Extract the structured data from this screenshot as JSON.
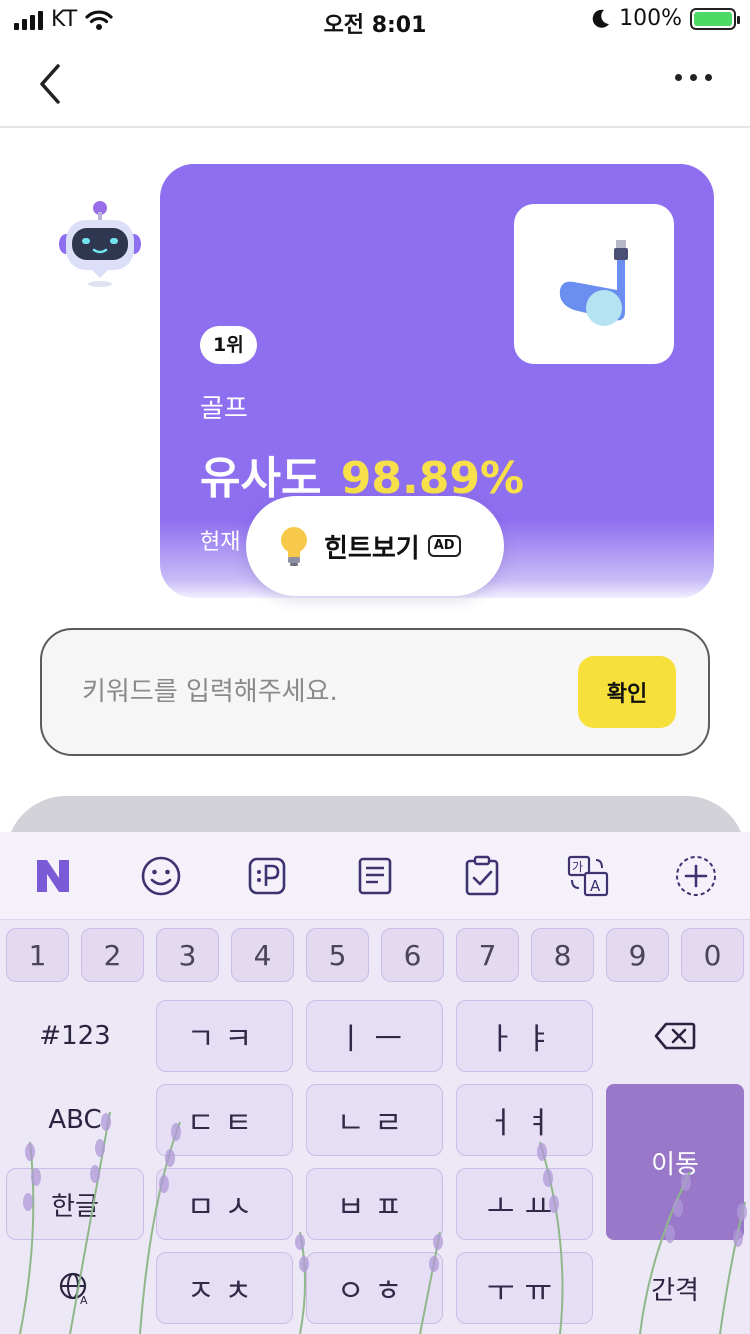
{
  "status_bar": {
    "carrier": "KT",
    "time": "오전 8:01",
    "battery": "100%"
  },
  "card": {
    "rank": "1위",
    "category": "골프",
    "similarity_label": "유사도",
    "similarity_value": "98.89%",
    "current_label": "현재"
  },
  "hint": {
    "label": "힌트보기",
    "ad": "AD"
  },
  "input": {
    "placeholder": "키워드를 입력해주세요.",
    "value": "",
    "confirm_label": "확인"
  },
  "keyboard": {
    "toolbar_icons": [
      "naver-n-icon",
      "emoji-icon",
      "sticker-p-icon",
      "memo-icon",
      "clipboard-icon",
      "translate-icon",
      "add-icon"
    ],
    "number_row": [
      "1",
      "2",
      "3",
      "4",
      "5",
      "6",
      "7",
      "8",
      "9",
      "0"
    ],
    "rows": [
      {
        "fn": "#123",
        "keys": [
          "ㄱㅋ",
          "ㅣㅡ",
          "ㅏㅑ"
        ],
        "end": "backspace"
      },
      {
        "fn": "ABC",
        "keys": [
          "ㄷㅌ",
          "ㄴㄹ",
          "ㅓㅕ"
        ],
        "end": "이동"
      },
      {
        "fn": "한글",
        "keys": [
          "ㅁㅅ",
          "ㅂㅍ",
          "ㅗㅛ"
        ]
      },
      {
        "fn": "globe",
        "keys": [
          "ㅈㅊ",
          "ㅇㅎ",
          "ㅜㅠ"
        ],
        "end": "간격"
      }
    ]
  }
}
